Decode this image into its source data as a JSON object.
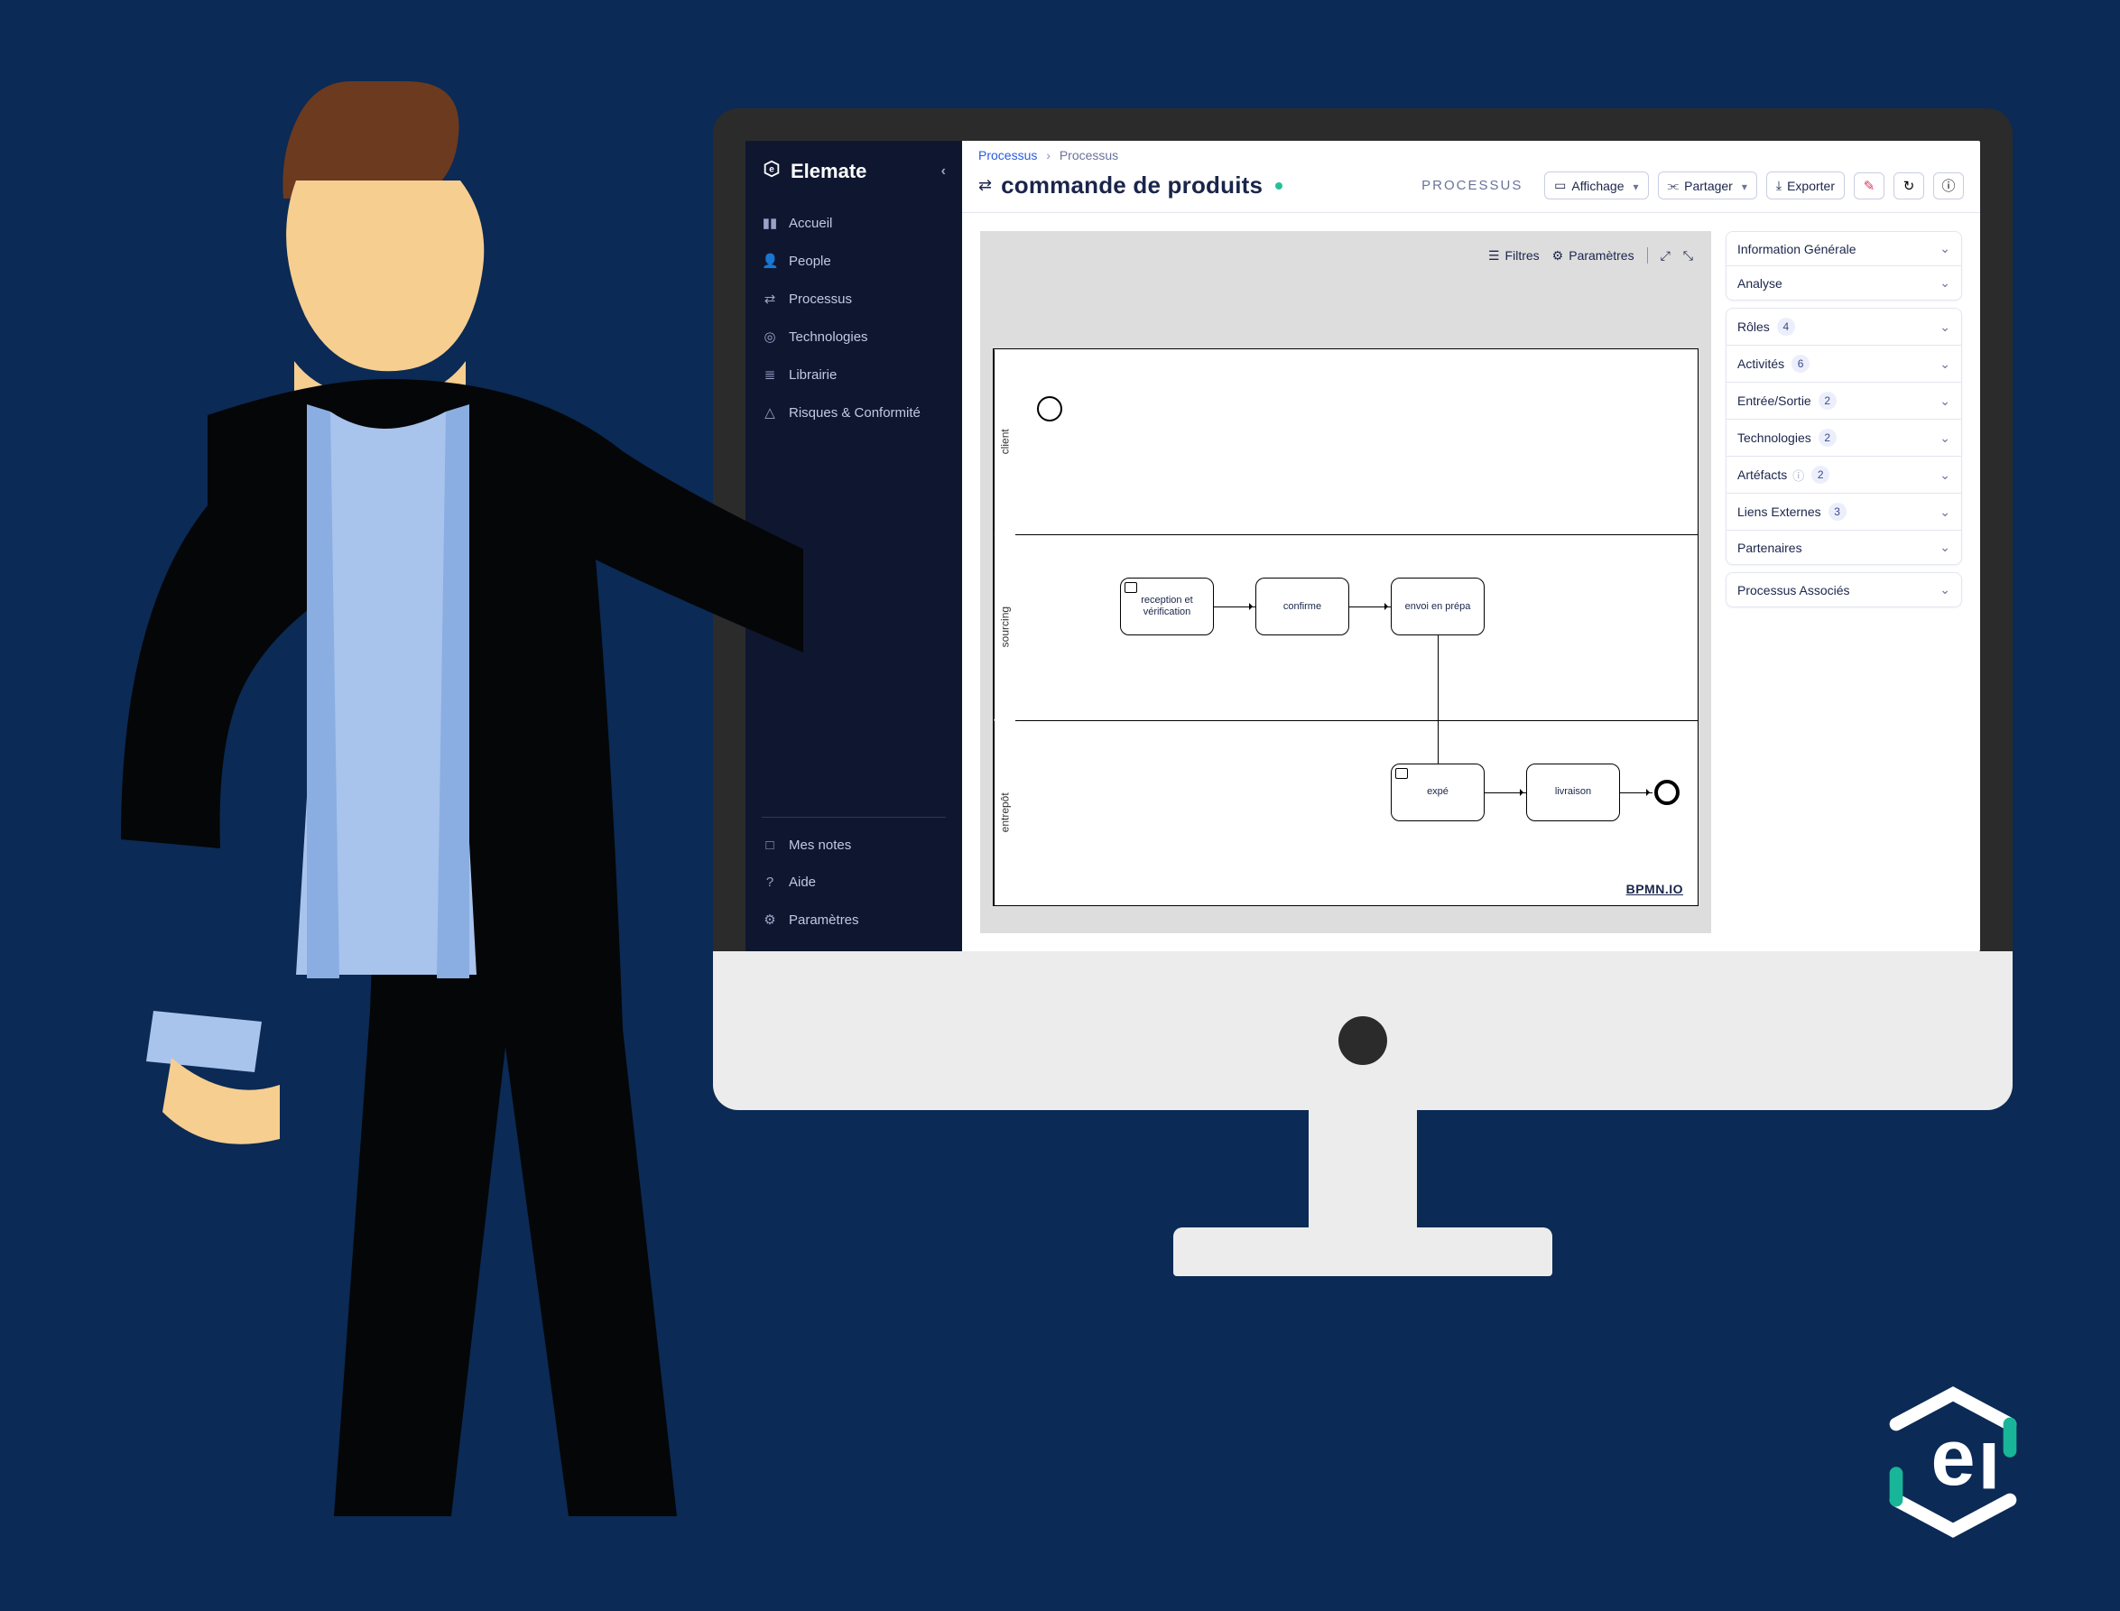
{
  "brand": {
    "name": "Elemate"
  },
  "sidebar": {
    "items": [
      {
        "icon": "home",
        "label": "Accueil"
      },
      {
        "icon": "users",
        "label": "People"
      },
      {
        "icon": "flow",
        "label": "Processus"
      },
      {
        "icon": "chip",
        "label": "Technologies"
      },
      {
        "icon": "book",
        "label": "Librairie"
      },
      {
        "icon": "alert",
        "label": "Risques & Conformité"
      }
    ],
    "footer": [
      {
        "icon": "note",
        "label": "Mes notes"
      },
      {
        "icon": "help",
        "label": "Aide"
      },
      {
        "icon": "gear",
        "label": "Paramètres"
      }
    ]
  },
  "breadcrumbs": {
    "root": "Processus",
    "current": "Processus"
  },
  "header": {
    "title": "commande de produits",
    "type_label": "PROCESSUS",
    "buttons": {
      "display": "Affichage",
      "share": "Partager",
      "export": "Exporter"
    }
  },
  "canvas": {
    "toolbar": {
      "filters": "Filtres",
      "params": "Paramètres"
    },
    "lanes": [
      "client",
      "sourcing",
      "entrepôt"
    ],
    "activities": {
      "a1": "reception et vérification",
      "a2": "confirme",
      "a3": "envoi en prépa",
      "a4": "expé",
      "a5": "livraison"
    },
    "watermark": "BPMN.IO"
  },
  "rightpanel": {
    "sections": [
      {
        "label": "Information Générale",
        "count": null
      },
      {
        "label": "Analyse",
        "count": null
      },
      {
        "label": "Rôles",
        "count": 4
      },
      {
        "label": "Activités",
        "count": 6
      },
      {
        "label": "Entrée/Sortie",
        "count": 2
      },
      {
        "label": "Technologies",
        "count": 2
      },
      {
        "label": "Artéfacts",
        "count": 2,
        "info": true
      },
      {
        "label": "Liens Externes",
        "count": 3
      },
      {
        "label": "Partenaires",
        "count": null
      },
      {
        "label": "Processus Associés",
        "count": null
      }
    ]
  }
}
